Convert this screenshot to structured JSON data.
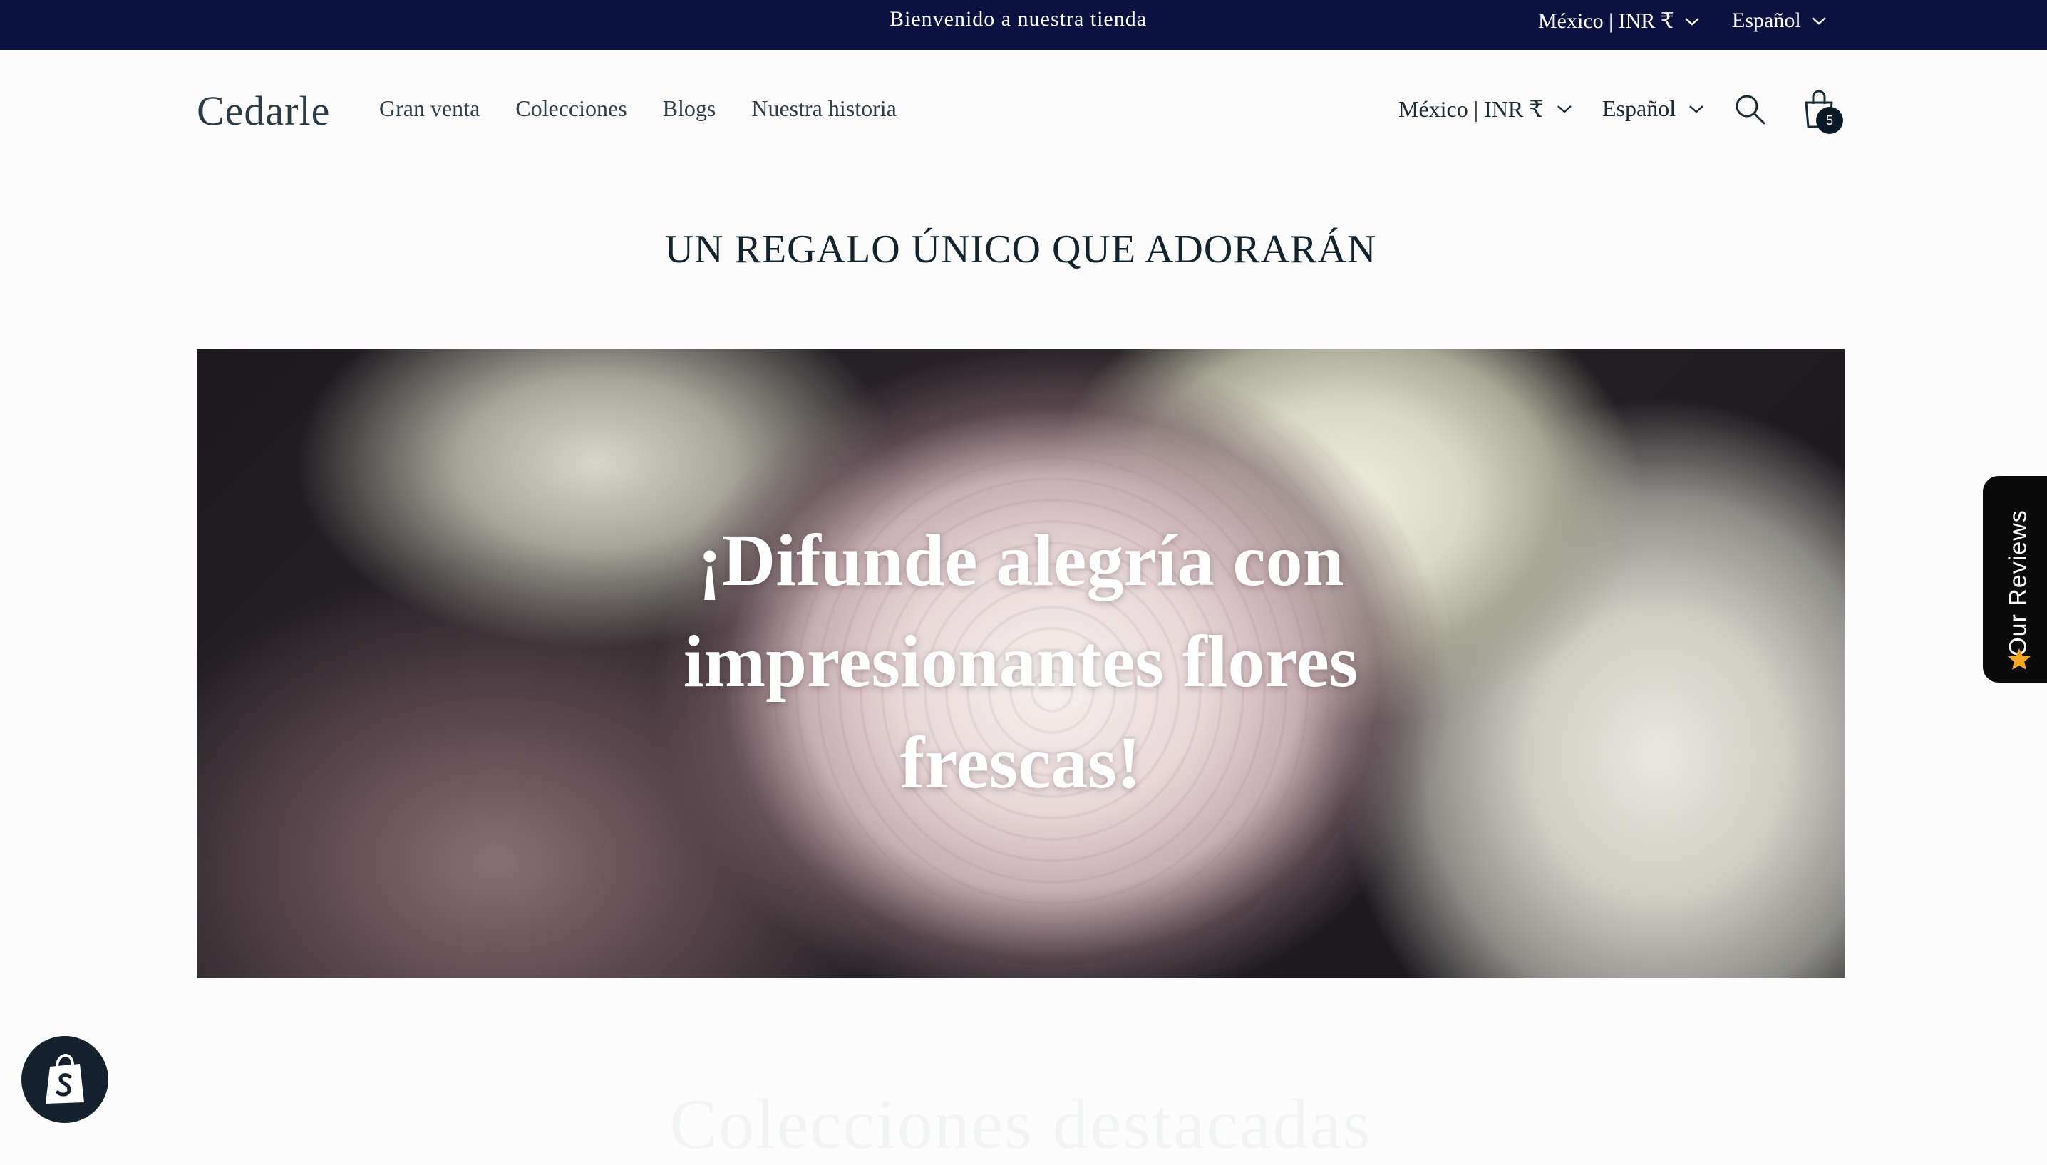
{
  "announcement": {
    "text": "Bienvenido a nuestra tienda",
    "country": "México | INR ₹",
    "language": "Español"
  },
  "header": {
    "logo": "Cedarle",
    "nav": [
      "Gran venta",
      "Colecciones",
      "Blogs",
      "Nuestra historia"
    ],
    "country": "México | INR ₹",
    "language": "Español",
    "cart_count": "5"
  },
  "section": {
    "title": "UN REGALO ÚNICO QUE ADORARÁN"
  },
  "hero": {
    "heading_line1": "¡Difunde alegría con",
    "heading_line2": "impresionantes flores",
    "heading_line3": "frescas!"
  },
  "reviews_tab": {
    "label": "Our Reviews"
  },
  "next_section": {
    "heading": "Colecciones destacadas"
  },
  "colors": {
    "announcement_bg": "#0b1140",
    "text_dark": "#14242e",
    "reviews_tab_bg": "#0a0a0a",
    "star": "#f5a623"
  },
  "icons": [
    "chevron-down-icon",
    "search-icon",
    "cart-icon",
    "star-icon",
    "shopify-bag-icon"
  ]
}
